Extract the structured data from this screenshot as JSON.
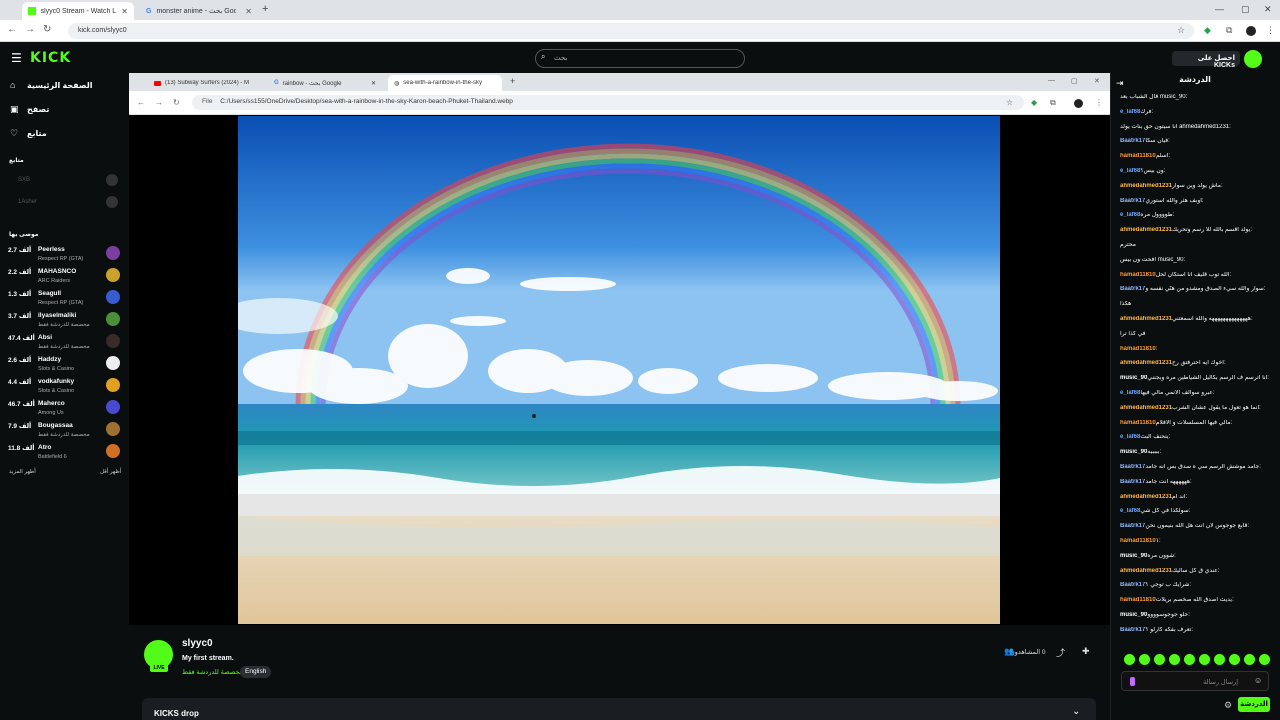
{
  "outer_browser": {
    "tabs": [
      {
        "title": "slyyc0 Stream - Watch Live on K",
        "active": true
      },
      {
        "title": "monster anime - بحث Google",
        "active": false
      }
    ],
    "url": "kick.com/slyyc0"
  },
  "header": {
    "logo": "KICK",
    "search_placeholder": "بحث",
    "get_kicks": "احصل على KICKs"
  },
  "sidebar": {
    "nav": [
      "الصفحة الرئيسية",
      "تصفح",
      "متابع"
    ],
    "following_label": "متابع",
    "following": [
      "SXB",
      "1Asher"
    ],
    "recommended_label": "موصى بها",
    "channels": [
      {
        "count": "2.7 ألف",
        "name": "Peerless",
        "category": "Respect RP (GTA)",
        "color": "#7b3fa0"
      },
      {
        "count": "2.2 ألف",
        "name": "MAHASNCO",
        "category": "ARC Raiders",
        "color": "#caa12c"
      },
      {
        "count": "1.3 ألف",
        "name": "Seagull",
        "category": "Respect RP (GTA)",
        "color": "#3a5ad0"
      },
      {
        "count": "3.7 ألف",
        "name": "ilyaselmaliki",
        "category": "مخصصة للدردشة فقط",
        "color": "#4a8f3a"
      },
      {
        "count": "47.4 ألف",
        "name": "Absi",
        "category": "مخصصة للدردشة فقط",
        "color": "#3a2a2a"
      },
      {
        "count": "2.6 ألف",
        "name": "Haddzy",
        "category": "Slots & Casino",
        "color": "#eeeeee"
      },
      {
        "count": "4.4 ألف",
        "name": "vodkafunky",
        "category": "Slots & Casino",
        "color": "#e0a020"
      },
      {
        "count": "46.7 ألف",
        "name": "Maherco",
        "category": "Among Us",
        "color": "#4a4ad0"
      },
      {
        "count": "7.9 ألف",
        "name": "Bougassaa",
        "category": "مخصصة للدردشة فقط",
        "color": "#a07030"
      },
      {
        "count": "11.8 ألف",
        "name": "Atro",
        "category": "Battlefield 6",
        "color": "#d07020"
      }
    ],
    "show_less": "أظهر أقل",
    "show_more": "أظهر المزيد"
  },
  "inner_browser": {
    "tabs": [
      {
        "title": "(13) Subway Surfers (2024) - M",
        "active": false
      },
      {
        "title": "rainbow - بحث Google",
        "active": false
      },
      {
        "title": "sea-with-a-rainbow-in-the-sky",
        "active": true
      }
    ],
    "file_label": "File",
    "url": "C:/Users/ss155/OneDrive/Desktop/sea-with-a-rainbow-in-the-sky-Karon-beach-Phuket-Thailand.webp"
  },
  "channel": {
    "name": "slyyc0",
    "live_badge": "LIVE",
    "title": "My first stream.",
    "category": "مخصصة للدردشة فقط",
    "language": "English",
    "viewers": "0 المشاهدون",
    "kicks_drop": "KICKS drop"
  },
  "chat": {
    "title": "الدردشة",
    "messages": [
      {
        "user": "",
        "text": "قال الشباب بعد music_90:",
        "color": "#ffffff"
      },
      {
        "user": "e_laf68",
        "text": "فرك:",
        "color": "#6ea8ff"
      },
      {
        "user": "",
        "text": "انا سيتون حق بنات يولد ahmedahmed1231:",
        "color": "#ffffff"
      },
      {
        "user": "Baatrk17",
        "text": "فيان سكا:",
        "color": "#8fb8ff"
      },
      {
        "user": "hamad11810",
        "text": "اسلم:",
        "color": "#ff9a3c"
      },
      {
        "user": "e_laf68",
        "text": "ون بيس؟:",
        "color": "#6ea8ff"
      },
      {
        "user": "ahmedahmed1231",
        "text": "ماش يولد وين سوار:",
        "color": "#ffb84d"
      },
      {
        "user": "Baatrk17",
        "text": "اوبف هثر والله استوري:",
        "color": "#8fb8ff"
      },
      {
        "user": "e_laf68",
        "text": "طوووول مره:",
        "color": "#6ea8ff"
      },
      {
        "user": "ahmedahmed1231",
        "text": "يولد اقسم بالله للا رسم وتحريك:",
        "color": "#ffb84d"
      },
      {
        "user": "",
        "text": "محترم",
        "color": "#ffffff"
      },
      {
        "user": "",
        "text": "افحت ون بيس music_90:",
        "color": "#ffffff"
      },
      {
        "user": "hamad11810",
        "text": "الله توب قليف انا استكان لحل:",
        "color": "#ff9a3c"
      },
      {
        "user": "Baatrk17",
        "text": "سوار والله سيء الصدق ومشدو من هنّي نفسه و:",
        "color": "#8fb8ff"
      },
      {
        "user": "",
        "text": "هكذا",
        "color": "#ffffff"
      },
      {
        "user": "ahmedahmed1231",
        "text": "ههههههههههههههه والله اسمعتني:",
        "color": "#ffb84d"
      },
      {
        "user": "",
        "text": "في كذا ترا",
        "color": "#ffffff"
      },
      {
        "user": "hamad11810",
        "text": ":",
        "color": "#ff9a3c"
      },
      {
        "user": "ahmedahmed1231",
        "text": "اخوك ايه احترفتق رح:",
        "color": "#ffb84d"
      },
      {
        "user": "music_90",
        "text": "انا اترسم ف الرسم بكاليل الشياطين مره وبجنني:",
        "color": "#ffffff"
      },
      {
        "user": "e_laf68",
        "text": "عبرو سوالف الأنمي مالي فيها:",
        "color": "#6ea8ff"
      },
      {
        "user": "ahmedahmed1231",
        "text": "انما هو تعول ما يقول عشان الشرب:",
        "color": "#ffb84d"
      },
      {
        "user": "hamad11810",
        "text": "مالي فيها المسلسلات و الافلام:",
        "color": "#ff9a3c"
      },
      {
        "user": "e_laf68",
        "text": "يتحنف البث:",
        "color": "#6ea8ff"
      },
      {
        "user": "music_90",
        "text": "ببببيه:",
        "color": "#ffffff"
      },
      {
        "user": "Baatrk17",
        "text": "جامد موشش الرسم سي ه سدق بس انه جامد:",
        "color": "#8fb8ff"
      },
      {
        "user": "Baatrk17",
        "text": "ههههههه انت جامد:",
        "color": "#8fb8ff"
      },
      {
        "user": "ahmedahmed1231",
        "text": "اند ام:",
        "color": "#ffb84d"
      },
      {
        "user": "e_laf68",
        "text": "سولكذا في كل شي:",
        "color": "#6ea8ff"
      },
      {
        "user": "Baatrk17",
        "text": "قابع جوجوس لان انت هل الله بنيمون نحن:",
        "color": "#8fb8ff"
      },
      {
        "user": "hamad11810",
        "text": "١:",
        "color": "#ff9a3c"
      },
      {
        "user": "music_90",
        "text": "شوون مره:",
        "color": "#ffffff"
      },
      {
        "user": "ahmedahmed1231",
        "text": "عندي ق كل ساليك:",
        "color": "#ffb84d"
      },
      {
        "user": "Baatrk17",
        "text": "شرايك ب توجي ؟:",
        "color": "#8fb8ff"
      },
      {
        "user": "hamad11810",
        "text": "يديث اصدق الله صخصم بريلات:",
        "color": "#ff9a3c"
      },
      {
        "user": "music_90",
        "text": "حلو جوجوسوووو:",
        "color": "#ffffff"
      },
      {
        "user": "Baatrk17",
        "text": "تعرف بفكه كارلو ؟:",
        "color": "#8fb8ff"
      }
    ],
    "input_placeholder": "إرسال رسالة",
    "send_label": "الدردشة"
  }
}
